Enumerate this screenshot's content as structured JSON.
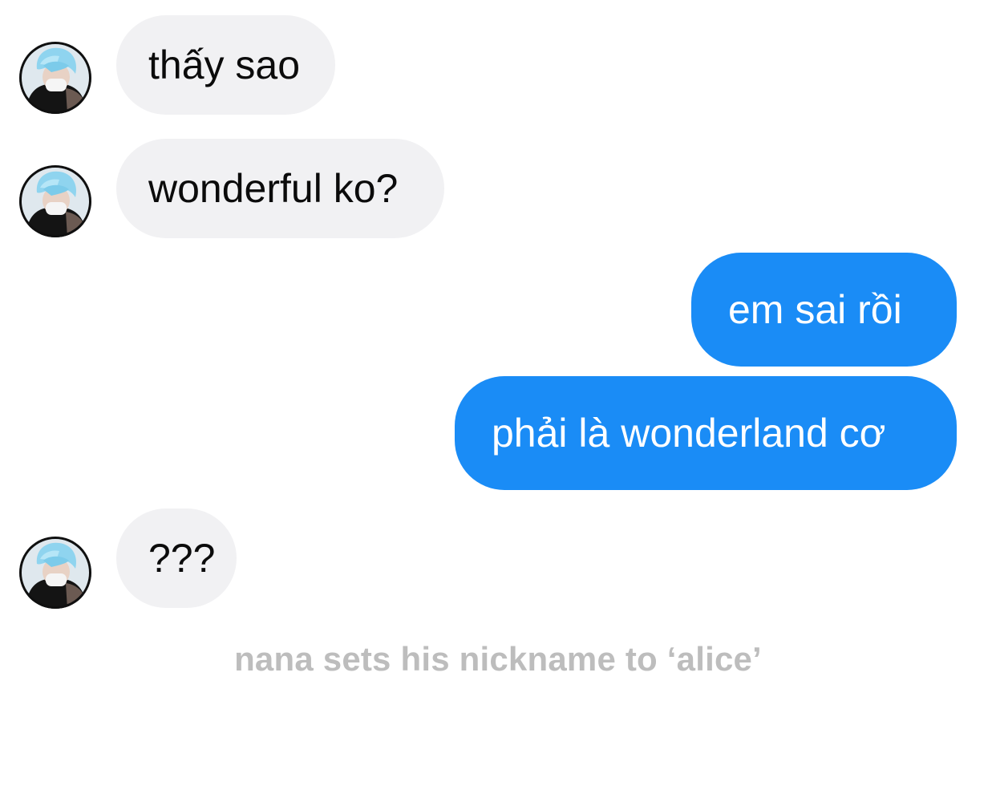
{
  "conversation": {
    "messages": [
      {
        "direction": "incoming",
        "text": "thấy sao"
      },
      {
        "direction": "incoming",
        "text": "wonderful ko?"
      },
      {
        "direction": "outgoing",
        "text": "em sai rồi"
      },
      {
        "direction": "outgoing",
        "text": "phải là wonderland cơ"
      },
      {
        "direction": "incoming",
        "text": "???"
      }
    ],
    "system_note": "nana sets his nickname to ‘alice’"
  },
  "colors": {
    "incoming_bubble": "#f1f1f3",
    "outgoing_bubble": "#1a8cf6",
    "system_note_text": "#bdbdbd"
  },
  "icons": {
    "avatar": "contact-avatar-photo"
  }
}
